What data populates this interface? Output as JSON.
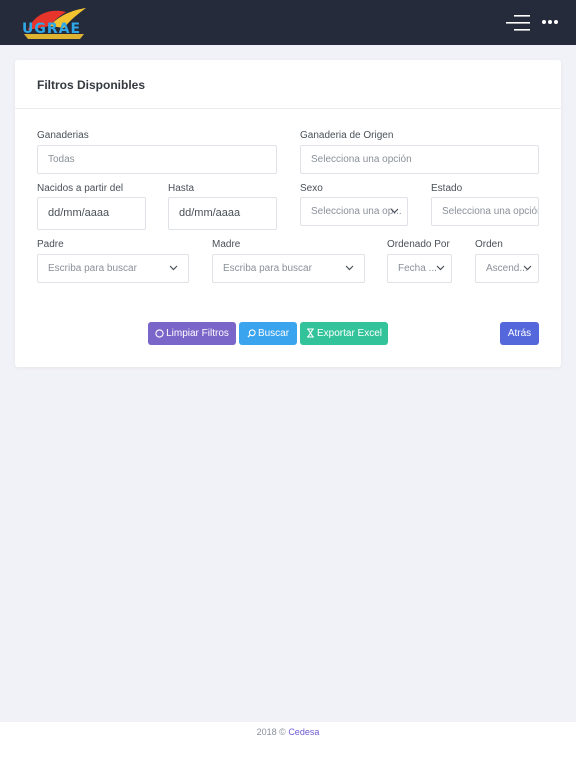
{
  "header": {
    "logo_text": "UGRAE"
  },
  "filters": {
    "title": "Filtros Disponibles",
    "ganaderias": {
      "label": "Ganaderias",
      "value": "Todas"
    },
    "ganaderia_origen": {
      "label": "Ganaderia de Origen",
      "placeholder": "Selecciona una opción"
    },
    "nacidos_desde": {
      "label": "Nacidos a partir del",
      "value": "dd/mm/aaaa"
    },
    "hasta": {
      "label": "Hasta",
      "value": "dd/mm/aaaa"
    },
    "sexo": {
      "label": "Sexo",
      "value": "Selecciona una op..."
    },
    "estado": {
      "label": "Estado",
      "value": "Selecciona una opción"
    },
    "padre": {
      "label": "Padre",
      "placeholder": "Escriba para buscar"
    },
    "madre": {
      "label": "Madre",
      "placeholder": "Escriba para buscar"
    },
    "ordenado_por": {
      "label": "Ordenado Por",
      "value": "Fecha ..."
    },
    "orden": {
      "label": "Orden",
      "value": "Ascend..."
    }
  },
  "actions": {
    "limpiar": "Limpiar Filtros",
    "buscar": "Buscar",
    "exportar": "Exportar Excel",
    "atras": "Atrás"
  },
  "footer": {
    "text": "2018 ©",
    "link": "Cedesa"
  },
  "colors": {
    "topbar": "#262b3c",
    "limpiar": "#7a65c9",
    "buscar": "#3aa4ee",
    "exportar": "#33c39a",
    "atras": "#5468dc"
  }
}
